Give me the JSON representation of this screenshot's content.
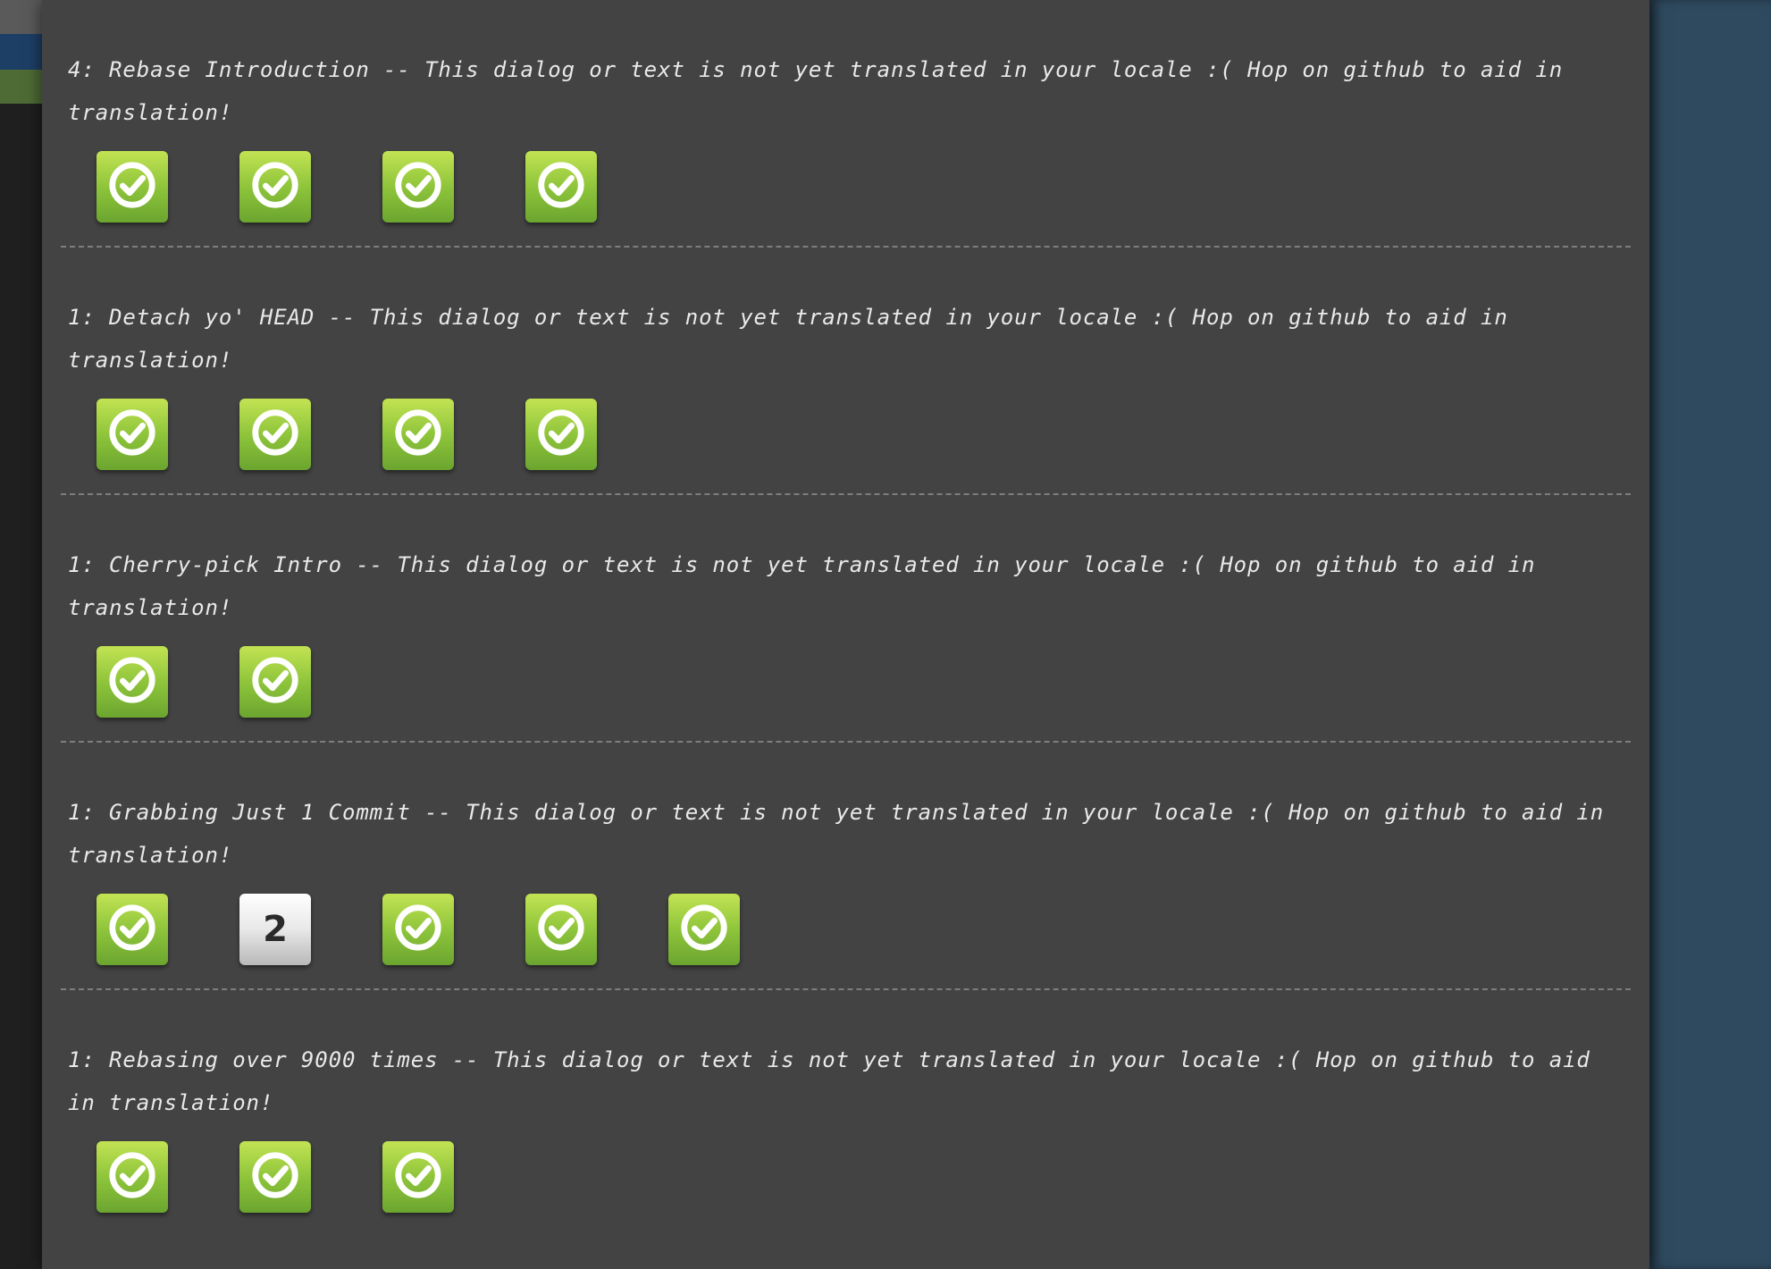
{
  "levels": [
    {
      "title": "4: Rebase Introduction -- This dialog or text is not yet translated in your locale :( Hop on github to aid in translation!",
      "items": [
        {
          "state": "done",
          "icon": "check-circle-icon"
        },
        {
          "state": "done",
          "icon": "check-circle-icon"
        },
        {
          "state": "done",
          "icon": "check-circle-icon"
        },
        {
          "state": "done",
          "icon": "check-circle-icon"
        }
      ]
    },
    {
      "title": "1: Detach yo' HEAD -- This dialog or text is not yet translated in your locale :( Hop on github to aid in translation!",
      "items": [
        {
          "state": "done",
          "icon": "check-circle-icon"
        },
        {
          "state": "done",
          "icon": "check-circle-icon"
        },
        {
          "state": "done",
          "icon": "check-circle-icon"
        },
        {
          "state": "done",
          "icon": "check-circle-icon"
        }
      ]
    },
    {
      "title": "1: Cherry-pick Intro -- This dialog or text is not yet translated in your locale :( Hop on github to aid in translation!",
      "items": [
        {
          "state": "done",
          "icon": "check-circle-icon"
        },
        {
          "state": "done",
          "icon": "check-circle-icon"
        }
      ]
    },
    {
      "title": "1: Grabbing Just 1 Commit -- This dialog or text is not yet translated in your locale :( Hop on github to aid in translation!",
      "items": [
        {
          "state": "done",
          "icon": "check-circle-icon"
        },
        {
          "state": "todo",
          "label": "2"
        },
        {
          "state": "done",
          "icon": "check-circle-icon"
        },
        {
          "state": "done",
          "icon": "check-circle-icon"
        },
        {
          "state": "done",
          "icon": "check-circle-icon"
        }
      ]
    },
    {
      "title": "1: Rebasing over 9000 times -- This dialog or text is not yet translated in your locale :( Hop on github to aid in translation!",
      "items": [
        {
          "state": "done",
          "icon": "check-circle-icon"
        },
        {
          "state": "done",
          "icon": "check-circle-icon"
        },
        {
          "state": "done",
          "icon": "check-circle-icon"
        }
      ]
    }
  ],
  "colors": {
    "panel": "#434343",
    "done_top": "#c2e353",
    "done_bottom": "#6ba52f",
    "todo_top": "#ffffff",
    "todo_bottom": "#b8b8b8",
    "backdrop": "#2f4a5f"
  }
}
